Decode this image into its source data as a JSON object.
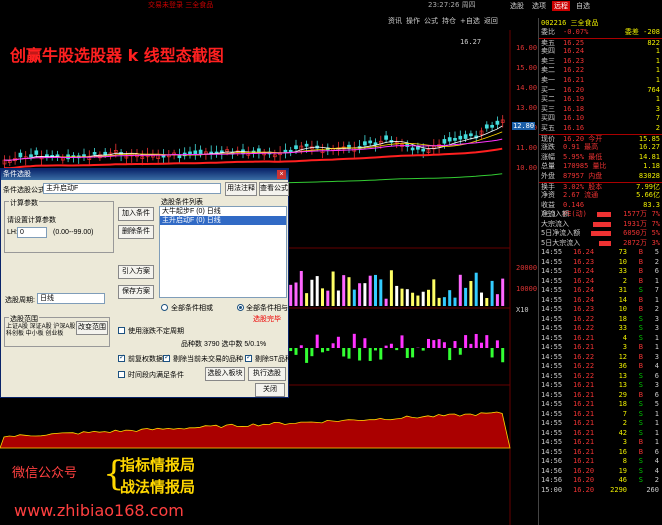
{
  "topbar": {
    "title": "交易未登录    三全食品",
    "time": "23:27:26 周四",
    "tabs": [
      "选股",
      "选项",
      "远程",
      "自选"
    ],
    "active_tab": "远程"
  },
  "toolbar": [
    "资讯",
    "操作",
    "公式",
    "持仓",
    "+自选",
    "返回"
  ],
  "overlay_title": "创赢牛股选股器 k 线型态截图",
  "price_axis": [
    "16.00",
    "15.00",
    "14.00",
    "13.00",
    "12.00",
    "11.00",
    "10.00"
  ],
  "chart_labels": {
    "high": "16.27",
    "ref": "12.80",
    "volume_ticks": [
      "20000",
      "10000"
    ],
    "macd_tick": "X10"
  },
  "quote": {
    "code": "002216 三全食品",
    "rows": [
      {
        "label": "委比",
        "v1": "-0.07%",
        "v2": "委差 -208"
      },
      {
        "label": "卖五",
        "v1": "16.25",
        "v2": "822"
      },
      {
        "label": "卖四",
        "v1": "16.24",
        "v2": "1"
      },
      {
        "label": "卖三",
        "v1": "16.23",
        "v2": "1"
      },
      {
        "label": "卖二",
        "v1": "16.22",
        "v2": "1"
      },
      {
        "label": "卖一",
        "v1": "16.21",
        "v2": "1"
      },
      {
        "label": "买一",
        "v1": "16.20",
        "v2": "764"
      },
      {
        "label": "买二",
        "v1": "16.19",
        "v2": "1"
      },
      {
        "label": "买三",
        "v1": "16.18",
        "v2": "3"
      },
      {
        "label": "买四",
        "v1": "16.10",
        "v2": "7"
      },
      {
        "label": "买五",
        "v1": "16.16",
        "v2": "2"
      },
      {
        "label": "现价",
        "v1": "16.20 今开",
        "v2": "15.85"
      },
      {
        "label": "涨跌",
        "v1": "0.91 最高",
        "v2": "16.27"
      },
      {
        "label": "涨幅",
        "v1": "5.95% 最低",
        "v2": "14.81"
      },
      {
        "label": "总量",
        "v1": "170985 量比",
        "v2": "1.18"
      },
      {
        "label": "外盘",
        "v1": "87957 内盘",
        "v2": "83028"
      },
      {
        "label": "换手",
        "v1": "3.02% 股本",
        "v2": "7.99亿"
      },
      {
        "label": "净资",
        "v1": "2.67 流通",
        "v2": "5.66亿"
      },
      {
        "label": "收益(三)",
        "v1": "0.146 PE(动)",
        "v2": "83.3"
      }
    ],
    "inflow": [
      {
        "k": "净流入额",
        "amt": "1577万",
        "pct": "7%"
      },
      {
        "k": "大宗流入",
        "amt": "1931万",
        "pct": "7%"
      },
      {
        "k": "5日净流入额",
        "amt": "6050万",
        "pct": "5%"
      },
      {
        "k": "5日大宗流入",
        "amt": "2872万",
        "pct": "3%"
      }
    ],
    "trades": [
      {
        "t": "14:55",
        "p": "16.24",
        "v": "73",
        "bs": "B",
        "c": "5"
      },
      {
        "t": "14:55",
        "p": "16.23",
        "v": "10",
        "bs": "B",
        "c": "2"
      },
      {
        "t": "14:55",
        "p": "16.24",
        "v": "33",
        "bs": "B",
        "c": "6"
      },
      {
        "t": "14:55",
        "p": "16.24",
        "v": "2",
        "bs": "B",
        "c": "1"
      },
      {
        "t": "14:55",
        "p": "16.24",
        "v": "31",
        "bs": "S",
        "c": "7"
      },
      {
        "t": "14:55",
        "p": "16.24",
        "v": "14",
        "bs": "B",
        "c": "1"
      },
      {
        "t": "14:55",
        "p": "16.23",
        "v": "10",
        "bs": "B",
        "c": "2"
      },
      {
        "t": "14:55",
        "p": "16.22",
        "v": "18",
        "bs": "S",
        "c": "3"
      },
      {
        "t": "14:55",
        "p": "16.22",
        "v": "33",
        "bs": "S",
        "c": "3"
      },
      {
        "t": "14:55",
        "p": "16.21",
        "v": "4",
        "bs": "S",
        "c": "1"
      },
      {
        "t": "14:55",
        "p": "16.21",
        "v": "3",
        "bs": "B",
        "c": "1"
      },
      {
        "t": "14:55",
        "p": "16.22",
        "v": "12",
        "bs": "B",
        "c": "3"
      },
      {
        "t": "14:55",
        "p": "16.22",
        "v": "36",
        "bs": "B",
        "c": "4"
      },
      {
        "t": "14:55",
        "p": "16.22",
        "v": "13",
        "bs": "S",
        "c": "6"
      },
      {
        "t": "14:55",
        "p": "16.21",
        "v": "13",
        "bs": "S",
        "c": "3"
      },
      {
        "t": "14:55",
        "p": "16.21",
        "v": "29",
        "bs": "B",
        "c": "6"
      },
      {
        "t": "14:55",
        "p": "16.21",
        "v": "18",
        "bs": "S",
        "c": "5"
      },
      {
        "t": "14:55",
        "p": "16.21",
        "v": "7",
        "bs": "S",
        "c": "1"
      },
      {
        "t": "14:55",
        "p": "16.21",
        "v": "2",
        "bs": "S",
        "c": "1"
      },
      {
        "t": "14:55",
        "p": "16.21",
        "v": "42",
        "bs": "S",
        "c": "1"
      },
      {
        "t": "14:55",
        "p": "16.21",
        "v": "3",
        "bs": "B",
        "c": "1"
      },
      {
        "t": "14:55",
        "p": "16.21",
        "v": "16",
        "bs": "B",
        "c": "6"
      },
      {
        "t": "14:56",
        "p": "16.21",
        "v": "8",
        "bs": "S",
        "c": "4"
      },
      {
        "t": "14:56",
        "p": "16.20",
        "v": "19",
        "bs": "S",
        "c": "4"
      },
      {
        "t": "14:56",
        "p": "16.20",
        "v": "46",
        "bs": "S",
        "c": "2"
      },
      {
        "t": "15:00",
        "p": "16.20",
        "v": "2290",
        "bs": "",
        "c": "260"
      }
    ]
  },
  "dialog": {
    "title": "条件选股",
    "formula_label": "条件选股公式",
    "formula_value": "主升启动F",
    "formula_btn": "用法注释",
    "view_btn": "查看公式",
    "params_group": "计算参数",
    "params_hint": "请设置计算参数",
    "param_label": "LH:",
    "param_value": "0",
    "param_range": "(0.00--99.00)",
    "add_btn": "加入条件",
    "del_btn": "删除条件",
    "import_btn": "引入方案",
    "save_btn": "保存方案",
    "cond_list_label": "选股条件列表",
    "cond_items": [
      "大牛起步F (0) 日线",
      "主升启动F (0) 日线"
    ],
    "period_label": "选股周期:",
    "period_value": "日线",
    "radio_or": "全部条件相或",
    "radio_and": "全部条件相与",
    "done_text": "选股完毕",
    "range_group": "选股范围",
    "range_text": "上证A股 深证A股 沪深A股 科创板 中小板 创业板",
    "change_range_btn": "改变范围",
    "use_period": "使用涨跌不定周期",
    "stats": "品种数 3790     选中数 5/0.1%",
    "chk1": "前复权数据",
    "chk2": "剔除当前未交易的品种",
    "chk3": "剔除ST品种",
    "chk4": "时间段内满足条件",
    "select_btn": "选股入板块",
    "run_btn": "执行选股",
    "close_btn": "关闭"
  },
  "watermark": {
    "wechat": "微信公众号",
    "line1": "指标情报局",
    "line2": "战法情报局",
    "url": "www.zhibiao168.com"
  }
}
